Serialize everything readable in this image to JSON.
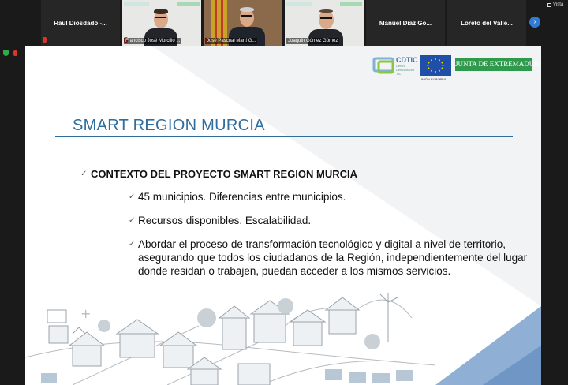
{
  "participants": [
    {
      "name": "Raul Diosdado -...",
      "video": false,
      "muted": true
    },
    {
      "name": "Francisco José Morcillo ...",
      "video": true,
      "muted": true
    },
    {
      "name": "José Pascual Martí G...",
      "video": true,
      "muted": true
    },
    {
      "name": "Joaquín Gómez Gómez",
      "video": true,
      "muted": false
    },
    {
      "name": "Manuel Díaz Go...",
      "video": false,
      "muted": false
    },
    {
      "name": "Loreto del Valle...",
      "video": false,
      "muted": false
    }
  ],
  "toolbar": {
    "view_label": "Vista",
    "next_icon": "chevron-right-icon"
  },
  "slide": {
    "logos": {
      "cdtic_name": "CDTIC",
      "cdtic_sub": "Centro Demostrador TIC",
      "eu_caption": "UNIÓN EUROPEA",
      "junta": "JUNTA DE EXTREMADURA"
    },
    "title": "SMART REGION MURCIA",
    "heading": "CONTEXTO DEL PROYECTO SMART REGION MURCIA",
    "points": [
      "45 municipios. Diferencias entre municipios.",
      "Recursos disponibles. Escalabilidad.",
      "Abordar el proceso de transformación tecnológico y digital a nivel de territorio, asegurando que todos los ciudadanos de la Región, independientemente del lugar donde residan o trabajen, puedan acceder a los mismos servicios."
    ],
    "tick": "✓"
  },
  "colors": {
    "title": "#2e6d9e",
    "junta_green": "#2f9a4b",
    "eu_blue": "#1f4fa6",
    "accent_blue": "#2f7bd6"
  }
}
